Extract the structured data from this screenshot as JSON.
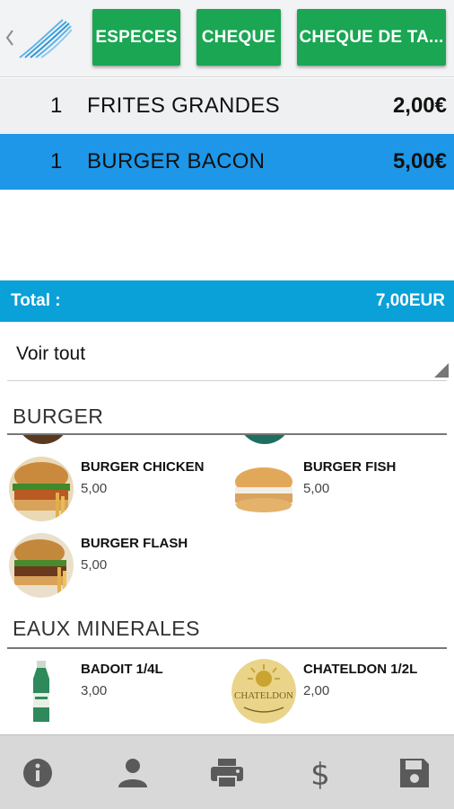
{
  "header": {
    "buttons": [
      {
        "label": "ESPECES"
      },
      {
        "label": "CHEQUE"
      },
      {
        "label": "CHEQUE DE TA..."
      }
    ],
    "accent": "#1aa653"
  },
  "order": {
    "lines": [
      {
        "qty": "1",
        "name": "FRITES GRANDES",
        "price": "2,00€"
      },
      {
        "qty": "1",
        "name": "BURGER BACON",
        "price": "5,00€"
      }
    ],
    "selected_color": "#1e97e8"
  },
  "total": {
    "label": "Total :",
    "value": "7,00EUR",
    "color": "#0aa0d8"
  },
  "filter": {
    "value": "Voir tout"
  },
  "catalog": {
    "sections": [
      {
        "title": "BURGER",
        "products": [
          {
            "name": "BURGER CHICKEN",
            "price": "5,00"
          },
          {
            "name": "BURGER FISH",
            "price": "5,00"
          },
          {
            "name": "BURGER FLASH",
            "price": "5,00"
          }
        ]
      },
      {
        "title": "EAUX MINERALES",
        "products": [
          {
            "name": "BADOIT 1/4L",
            "price": "3,00"
          },
          {
            "name": "CHATELDON 1/2L",
            "price": "2,00",
            "logo_text": "CHATELDON"
          }
        ]
      }
    ]
  },
  "bottom_bar": {
    "icons": [
      "info-icon",
      "person-icon",
      "print-icon",
      "dollar-icon",
      "save-icon"
    ]
  }
}
